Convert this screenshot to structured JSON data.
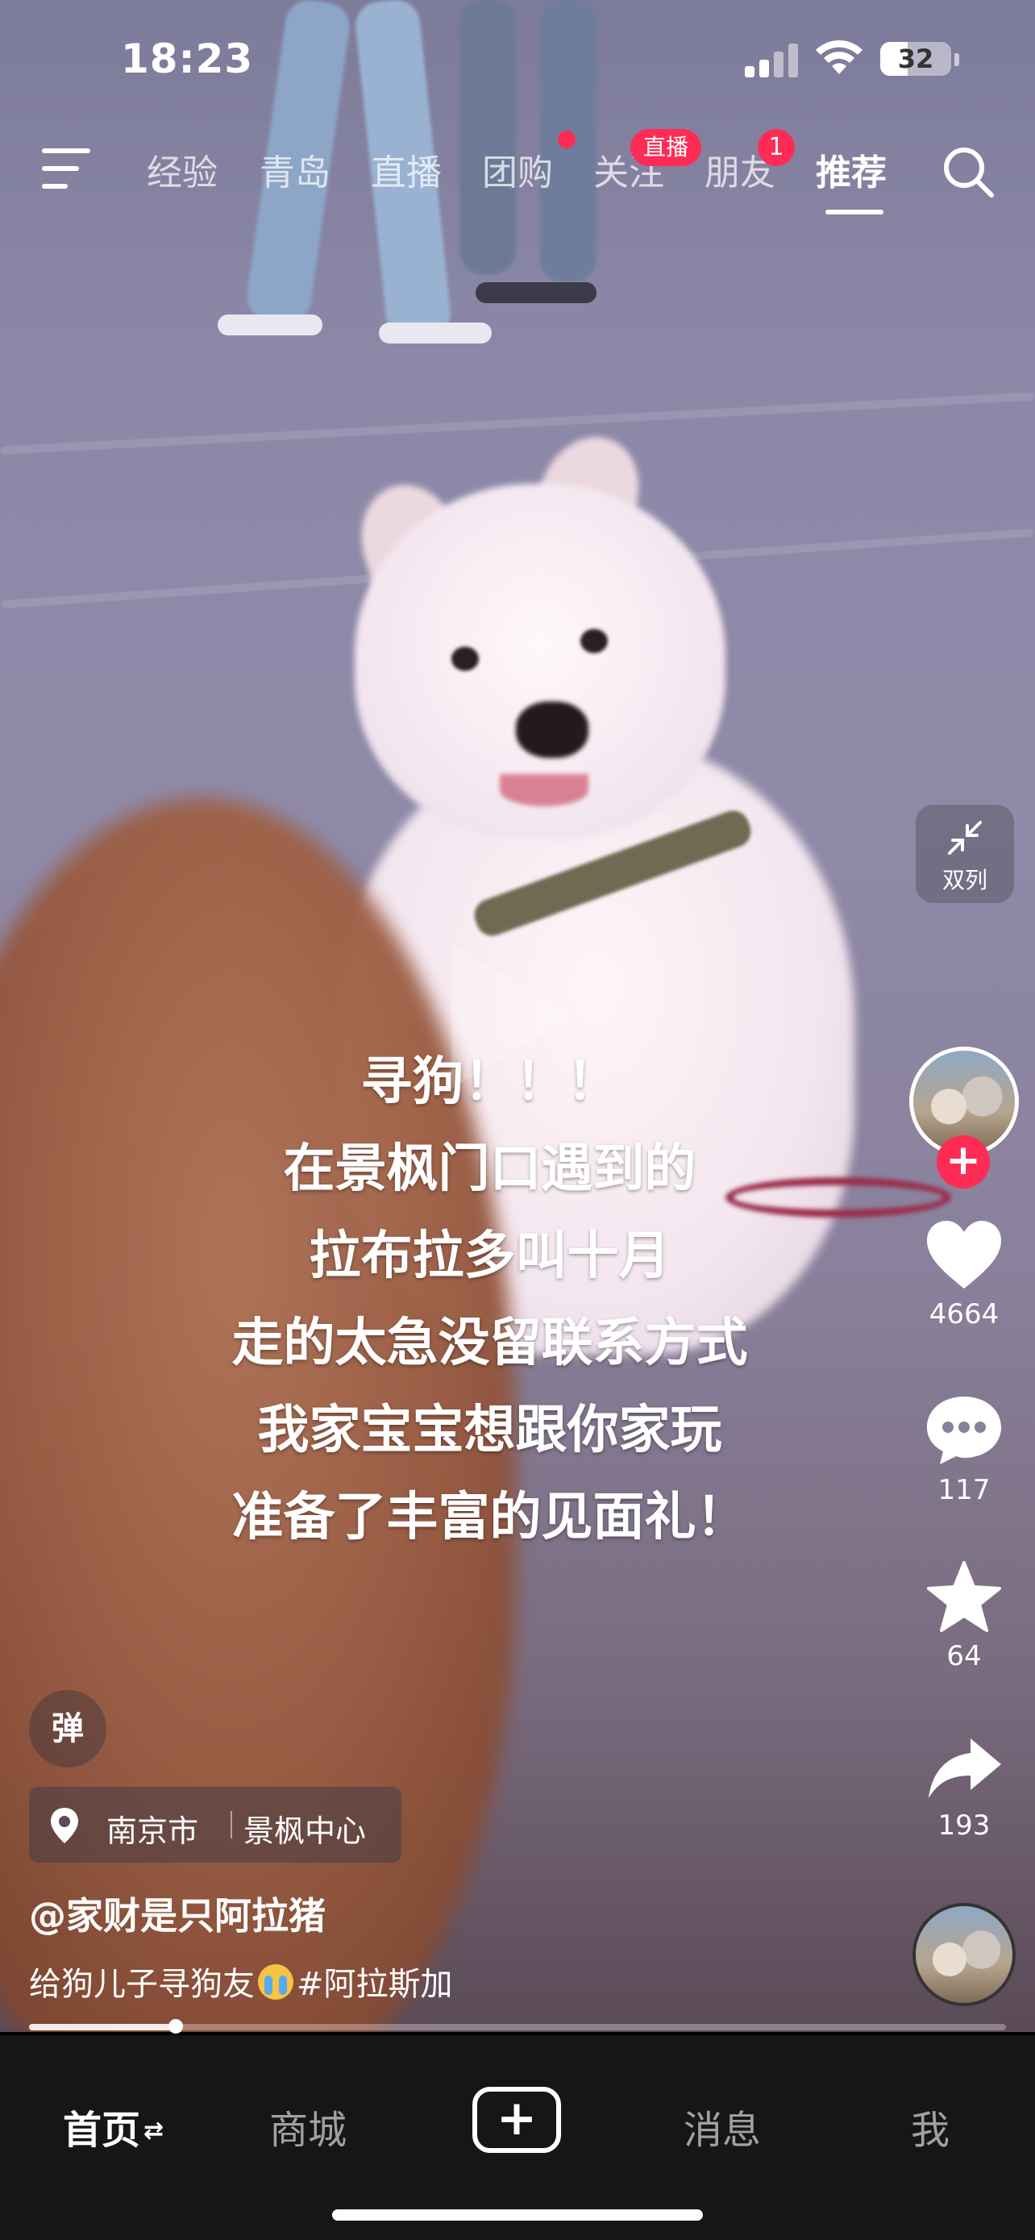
{
  "status_bar": {
    "time": "18:23",
    "battery": "32"
  },
  "top_nav": {
    "tabs": [
      "经验",
      "青岛",
      "直播",
      "团购",
      "关注",
      "朋友",
      "推荐"
    ],
    "active_tab": "推荐",
    "live_badge": "直播",
    "friends_badge": "1"
  },
  "video": {
    "overlay_lines": [
      "寻狗！！！",
      "在景枫门口遇到的",
      "拉布拉多叫十月",
      "走的太急没留联系方式",
      "我家宝宝想跟你家玩",
      "准备了丰富的见面礼！"
    ],
    "progress": 0.15
  },
  "side_actions": {
    "double_column_label": "双列",
    "likes": "4664",
    "comments": "117",
    "favorites": "64",
    "shares": "193"
  },
  "bottom_info": {
    "danmu_label": "弹",
    "location_city": "南京市",
    "location_place": "景枫中心",
    "author": "@家财是只阿拉猪",
    "caption_prefix": "给狗儿子寻狗友",
    "caption_hashtag": "#阿拉斯加"
  },
  "bottom_nav": {
    "home": "首页",
    "mall": "商城",
    "messages": "消息",
    "me": "我"
  },
  "colors": {
    "accent": "#fe2c55",
    "bar_bg": "#161616"
  }
}
